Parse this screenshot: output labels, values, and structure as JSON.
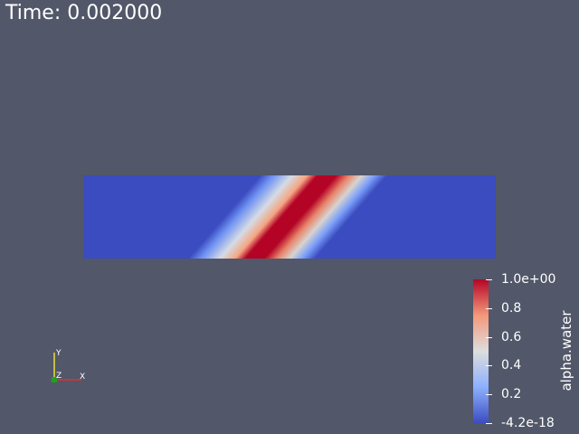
{
  "time_label": "Time: 0.002000",
  "colors": {
    "background": "#525769",
    "low": "#3b4cc0",
    "mid": "#dddddd",
    "high": "#b40426",
    "x_axis": "#e03030",
    "y_axis": "#e8e03a",
    "z_axis": "#20a020"
  },
  "colorbar": {
    "title": "alpha.water",
    "tick_labels": [
      "1.0e+00",
      "0.8",
      "0.6",
      "0.4",
      "0.2",
      "-4.2e-18"
    ],
    "tick_values": [
      1.0,
      0.8,
      0.6,
      0.4,
      0.2,
      0.0
    ],
    "range": [
      -4.2e-18,
      1.0
    ],
    "colormap": "cool-to-warm"
  },
  "orientation_axes": {
    "x_label": "X",
    "y_label": "Y",
    "z_label": "Z"
  }
}
